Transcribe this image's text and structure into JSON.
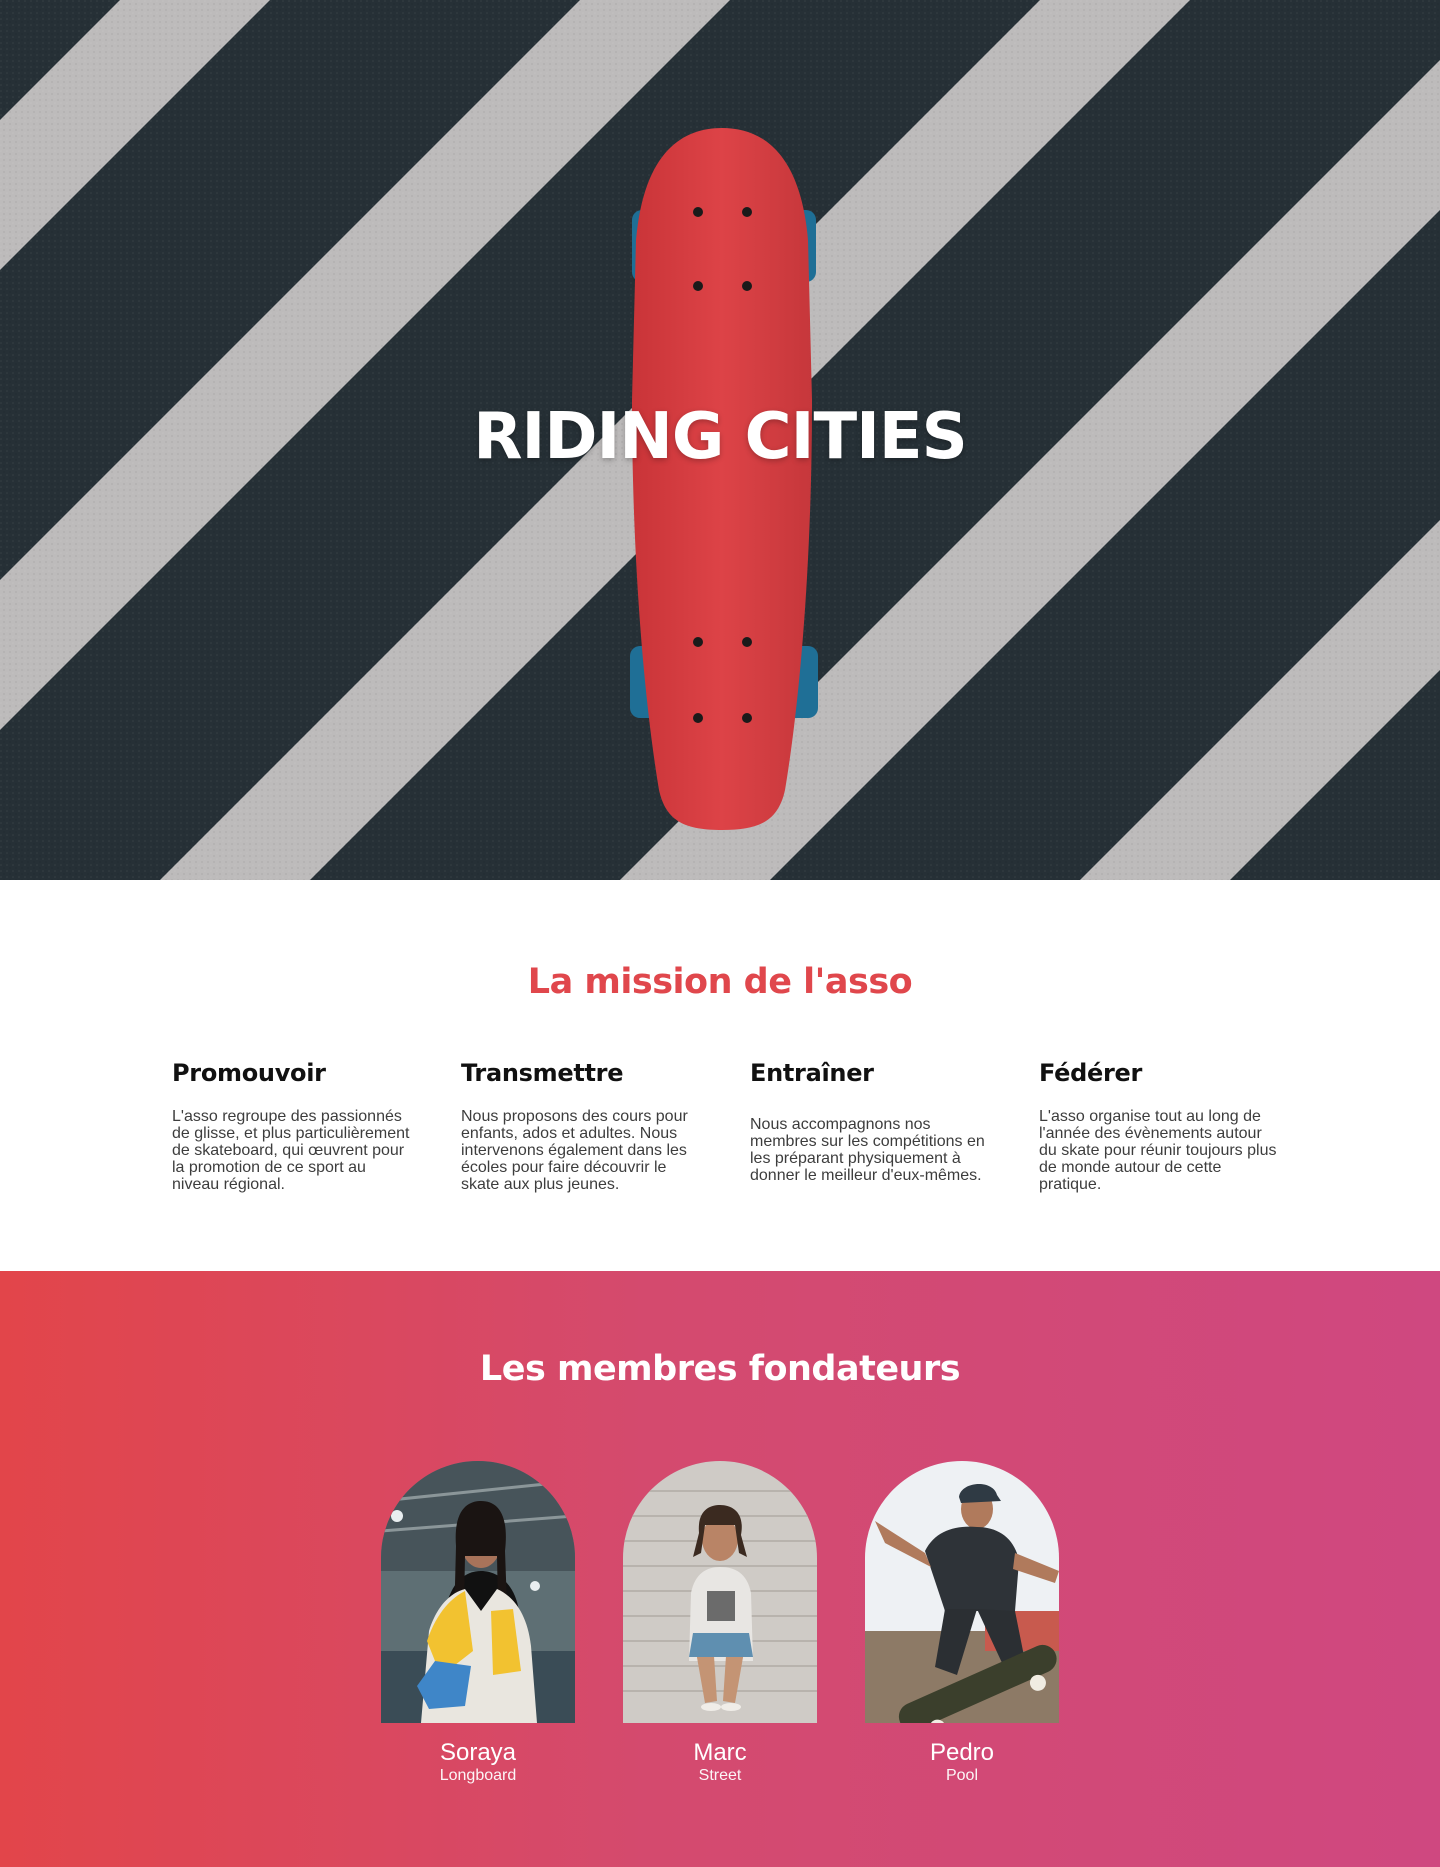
{
  "hero": {
    "title": "RIDING CITIES",
    "image": "skateboard-on-crosswalk",
    "colors": {
      "asphalt": "#263036",
      "stripe": "#bdbbbb",
      "board": "#d63a3e",
      "wheels": "#1f6f96"
    }
  },
  "mission": {
    "title": "La mission de l'asso",
    "title_color": "#e0474c",
    "items": [
      {
        "heading": "Promouvoir",
        "text": "L'asso regroupe des passionnés de glisse, et plus particulièrement de skateboard, qui œuvrent pour la promotion de ce sport au niveau régional."
      },
      {
        "heading": "Transmettre",
        "text": "Nous proposons des cours pour enfants, ados et adultes. Nous intervenons également dans les écoles pour faire découvrir le skate aux plus jeunes."
      },
      {
        "heading": "Entraîner",
        "text": "Nous accompagnons nos membres sur les compétitions en les préparant physiquement à donner le meilleur d'eux-mêmes."
      },
      {
        "heading": "Fédérer",
        "text": "L'asso organise tout au long de l'année des évènements autour du skate pour réunir toujours plus de monde autour de cette pratique."
      }
    ]
  },
  "founders": {
    "title": "Les membres fondateurs",
    "gradient": [
      "#e2454a",
      "#cf4880"
    ],
    "members": [
      {
        "name": "Soraya",
        "role": "Longboard",
        "photo": "woman-portrait-photo"
      },
      {
        "name": "Marc",
        "role": "Street",
        "photo": "man-sitting-on-steps-photo"
      },
      {
        "name": "Pedro",
        "role": "Pool",
        "photo": "skater-trick-photo"
      }
    ]
  }
}
